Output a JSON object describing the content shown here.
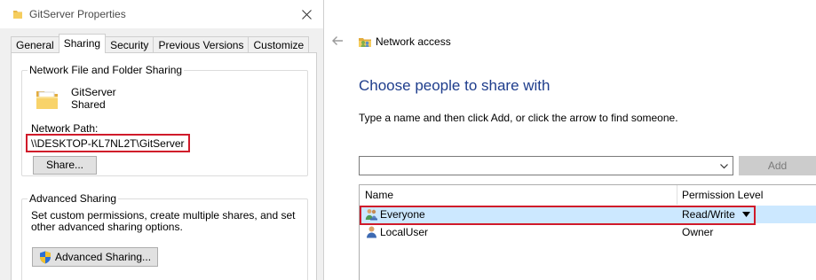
{
  "props": {
    "title": "GitServer Properties",
    "tabs": [
      "General",
      "Sharing",
      "Security",
      "Previous Versions",
      "Customize"
    ],
    "active_tab": "Sharing",
    "network": {
      "group_title": "Network File and Folder Sharing",
      "folder_name": "GitServer",
      "folder_status": "Shared",
      "path_label": "Network Path:",
      "path_value": "\\\\DESKTOP-KL7NL2T\\GitServer",
      "share_button": "Share..."
    },
    "advanced": {
      "group_title": "Advanced Sharing",
      "description": "Set custom permissions, create multiple shares, and set other advanced sharing options.",
      "button": "Advanced Sharing..."
    }
  },
  "wizard": {
    "title": "Network access",
    "heading": "Choose people to share with",
    "instruction": "Type a name and then click Add, or click the arrow to find someone.",
    "name_input_value": "",
    "add_button": "Add",
    "columns": {
      "name": "Name",
      "permission": "Permission Level"
    },
    "rows": [
      {
        "name": "Everyone",
        "permission": "Read/Write",
        "selected": true,
        "icon": "group-icon"
      },
      {
        "name": "LocalUser",
        "permission": "Owner",
        "selected": false,
        "icon": "user-icon"
      }
    ]
  },
  "colors": {
    "highlight_border": "#d01a2a",
    "heading_blue": "#1e3d8c",
    "selection": "#cce8ff"
  }
}
